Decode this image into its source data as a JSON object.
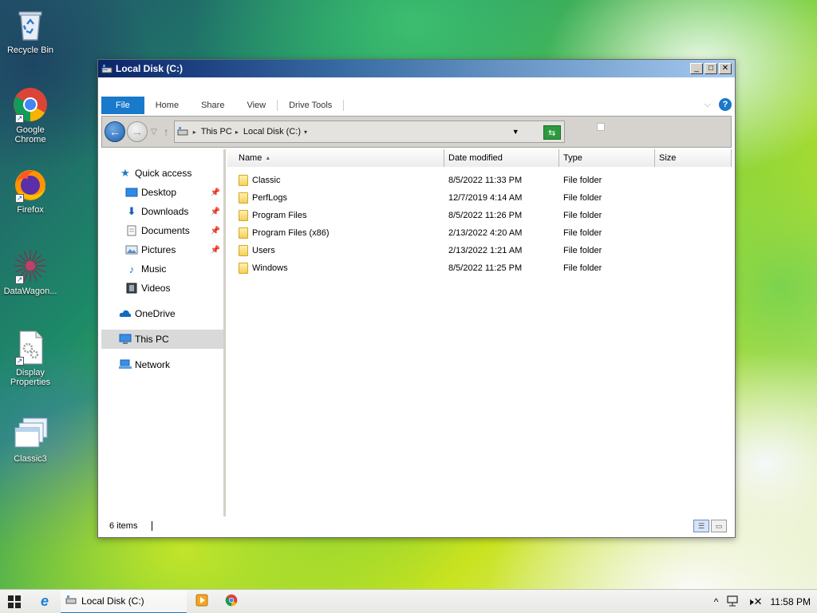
{
  "desktop": {
    "icons": [
      {
        "label": "Recycle Bin",
        "icon": "recycle-bin-icon"
      },
      {
        "label": "Google Chrome",
        "icon": "chrome-icon"
      },
      {
        "label": "Firefox",
        "icon": "firefox-icon"
      },
      {
        "label": "DataWagon...",
        "icon": "datawagon-icon"
      },
      {
        "label": "Display Properties",
        "icon": "display-properties-icon"
      },
      {
        "label": "Classic3",
        "icon": "classic3-icon"
      }
    ]
  },
  "window": {
    "title": "Local Disk (C:)",
    "controls": {
      "minimize": "_",
      "maximize": "□",
      "close": "✕"
    }
  },
  "ribbon": {
    "tabs": [
      "File",
      "Home",
      "Share",
      "View",
      "Drive Tools"
    ],
    "help": "?"
  },
  "address": {
    "crumbs": [
      "This PC",
      "Local Disk (C:)"
    ]
  },
  "nav_pane": {
    "quick_access": "Quick access",
    "quick_items": [
      "Desktop",
      "Downloads",
      "Documents",
      "Pictures",
      "Music",
      "Videos"
    ],
    "onedrive": "OneDrive",
    "this_pc": "This PC",
    "network": "Network"
  },
  "columns": {
    "name": "Name",
    "date": "Date modified",
    "type": "Type",
    "size": "Size"
  },
  "files": [
    {
      "name": "Classic",
      "date": "8/5/2022 11:33 PM",
      "type": "File folder",
      "size": ""
    },
    {
      "name": "PerfLogs",
      "date": "12/7/2019 4:14 AM",
      "type": "File folder",
      "size": ""
    },
    {
      "name": "Program Files",
      "date": "8/5/2022 11:26 PM",
      "type": "File folder",
      "size": ""
    },
    {
      "name": "Program Files (x86)",
      "date": "2/13/2022 4:20 AM",
      "type": "File folder",
      "size": ""
    },
    {
      "name": "Users",
      "date": "2/13/2022 1:21 AM",
      "type": "File folder",
      "size": ""
    },
    {
      "name": "Windows",
      "date": "8/5/2022 11:25 PM",
      "type": "File folder",
      "size": ""
    }
  ],
  "status": {
    "items": "6 items"
  },
  "taskbar": {
    "active_window": "Local Disk (C:)",
    "clock": "11:58 PM"
  },
  "colors": {
    "accent": "#1979ca",
    "selection": "#d9d9d9",
    "folder": "#f5cf5a"
  }
}
